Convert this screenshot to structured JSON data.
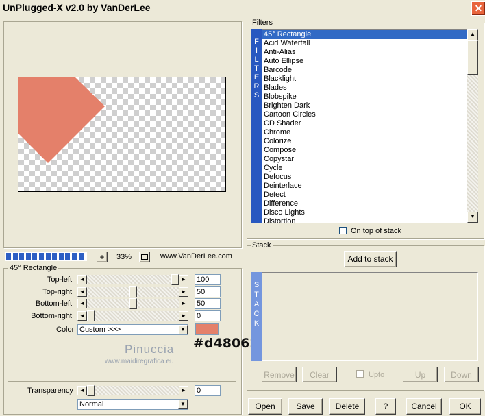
{
  "window": {
    "title": "UnPlugged-X v2.0 by VanDerLee",
    "close_symbol": "✕"
  },
  "preview": {
    "zoom": "33%",
    "website": "www.VanDerLee.com",
    "progress_segments": 12,
    "shape_color": "#e4806a"
  },
  "filters": {
    "group_label": "Filters",
    "side_label": [
      "F",
      "I",
      "L",
      "T",
      "E",
      "R",
      "S"
    ],
    "items": [
      "45° Rectangle",
      "Acid Waterfall",
      "Anti-Alias",
      "Auto Ellipse",
      "Barcode",
      "Blacklight",
      "Blades",
      "Blobspike",
      "Brighten Dark",
      "Cartoon Circles",
      "CD Shader",
      "Chrome",
      "Colorize",
      "Compose",
      "Copystar",
      "Cycle",
      "Defocus",
      "Deinterlace",
      "Detect",
      "Difference",
      "Disco Lights",
      "Distortion"
    ],
    "selected_index": 0,
    "on_top_label": "On top of stack"
  },
  "params": {
    "group_label": "45° Rectangle",
    "sliders": [
      {
        "label": "Top-left",
        "value": "100",
        "level": 1.0
      },
      {
        "label": "Top-right",
        "value": "50",
        "level": 0.5
      },
      {
        "label": "Bottom-left",
        "value": "50",
        "level": 0.5
      },
      {
        "label": "Bottom-right",
        "value": "0",
        "level": 0.0
      }
    ],
    "color_label": "Color",
    "color_select": "Custom >>>",
    "color_swatch": "#e4806a",
    "color_hex": "#d48062",
    "watermark_name": "Pinuccia",
    "watermark_url": "www.maidiregrafica.eu",
    "transparency_label": "Transparency",
    "transparency_value": "0",
    "transparency_level": 0.0,
    "blend_mode": "Normal"
  },
  "stack": {
    "group_label": "Stack",
    "add_label": "Add to stack",
    "side_label": [
      "S",
      "T",
      "A",
      "C",
      "K"
    ],
    "remove_label": "Remove",
    "clear_label": "Clear",
    "upto_label": "Upto",
    "up_label": "Up",
    "down_label": "Down"
  },
  "footer": {
    "open_label": "Open",
    "save_label": "Save",
    "delete_label": "Delete",
    "help_label": "?",
    "cancel_label": "Cancel",
    "ok_label": "OK"
  }
}
